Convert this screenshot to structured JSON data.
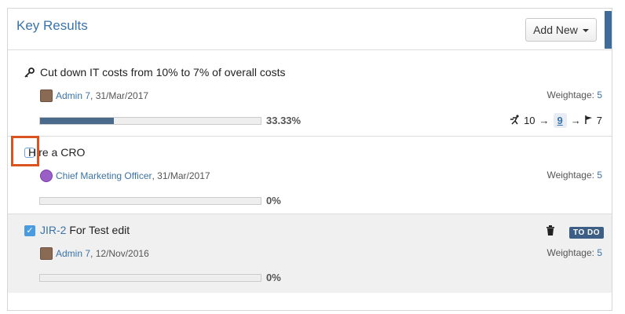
{
  "panel": {
    "title": "Key Results",
    "add_new_label": "Add New"
  },
  "key_results": [
    {
      "title": "Cut down IT costs from 10% to 7% of overall costs",
      "owner": "Admin 7",
      "date": ", 31/Mar/2017",
      "weightage_label": "Weightage: ",
      "weightage": "5",
      "progress_pct": 33.33,
      "progress_text": "33.33%",
      "start": "10",
      "current": "9",
      "target": "7"
    },
    {
      "title": "Hire a CRO",
      "owner": "Chief Marketing Officer",
      "date": ", 31/Mar/2017",
      "weightage_label": "Weightage: ",
      "weightage": "5",
      "progress_pct": 0,
      "progress_text": "0%"
    },
    {
      "issue_key": "JIR-2",
      "title": "For Test edit",
      "owner": "Admin 7",
      "date": ", 12/Nov/2016",
      "weightage_label": "Weightage: ",
      "weightage": "5",
      "progress_pct": 0,
      "progress_text": "0%",
      "status": "TO DO"
    }
  ],
  "colors": {
    "accent": "#3f6b9b",
    "link": "#3b73a8",
    "progress_fill": "#4a6a8c",
    "highlight": "#d9541e",
    "status_badge": "#3e5f85"
  },
  "icons": [
    "key-icon",
    "runner-icon",
    "arrow-right-icon",
    "flag-icon",
    "trash-icon",
    "checkbox-icon",
    "checkbox-checked-icon"
  ]
}
